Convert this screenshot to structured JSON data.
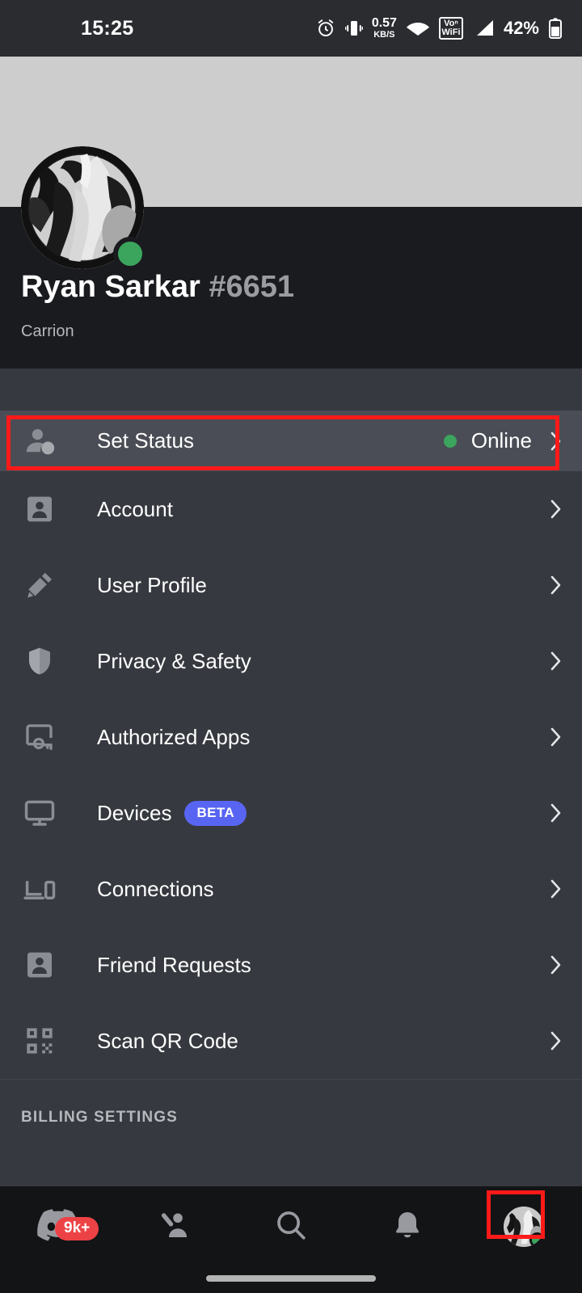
{
  "status_bar": {
    "time": "15:25",
    "alarm_icon": "alarm-icon",
    "vibrate_icon": "vibrate-icon",
    "net_speed_value": "0.57",
    "net_speed_unit": "KB/S",
    "wifi_icon": "wifi-icon",
    "vowifi_line1": "Voⁿ",
    "vowifi_line2": "WiFi",
    "signal_icon": "cellular-signal-icon",
    "battery_percent": "42%",
    "battery_icon": "battery-icon"
  },
  "profile": {
    "banner_color": "#cdcdcd",
    "avatar_name": "user-avatar",
    "presence_color": "#3ba55d",
    "display_name": "Ryan Sarkar",
    "discriminator": "#6651",
    "custom_status": "Carrion"
  },
  "settings": {
    "rows": [
      {
        "key": "set-status",
        "label": "Set Status",
        "icon": "person-status-icon",
        "value": "Online",
        "has_status_dot": true,
        "highlighted": true
      },
      {
        "key": "account",
        "label": "Account",
        "icon": "id-card-person-icon"
      },
      {
        "key": "user-profile",
        "label": "User Profile",
        "icon": "pencil-icon"
      },
      {
        "key": "privacy-safety",
        "label": "Privacy & Safety",
        "icon": "shield-icon"
      },
      {
        "key": "authorized-apps",
        "label": "Authorized Apps",
        "icon": "authorized-apps-icon"
      },
      {
        "key": "devices",
        "label": "Devices",
        "icon": "monitor-icon",
        "badge": "BETA",
        "badge_color": "#5865f2"
      },
      {
        "key": "connections",
        "label": "Connections",
        "icon": "laptop-phone-icon"
      },
      {
        "key": "friend-requests",
        "label": "Friend Requests",
        "icon": "id-card-person-icon"
      },
      {
        "key": "scan-qr-code",
        "label": "Scan QR Code",
        "icon": "qr-code-icon"
      }
    ],
    "section_header": "BILLING SETTINGS",
    "chevron_icon": "chevron-right-icon"
  },
  "bottom_nav": {
    "items": [
      {
        "key": "servers",
        "icon": "discord-logo-icon",
        "badge": "9k+",
        "badge_color": "#ed4245"
      },
      {
        "key": "friends",
        "icon": "friends-icon"
      },
      {
        "key": "search",
        "icon": "search-icon"
      },
      {
        "key": "mentions",
        "icon": "bell-icon"
      },
      {
        "key": "profile",
        "icon": "user-avatar-icon",
        "presence_color": "#3ba55d",
        "selected": true
      }
    ]
  },
  "annotations": {
    "color": "#ff1a1a",
    "boxes": [
      {
        "key": "set-status-row-highlight",
        "target": "Set Status"
      },
      {
        "key": "profile-tab-highlight",
        "target": "bottom nav avatar"
      }
    ]
  }
}
